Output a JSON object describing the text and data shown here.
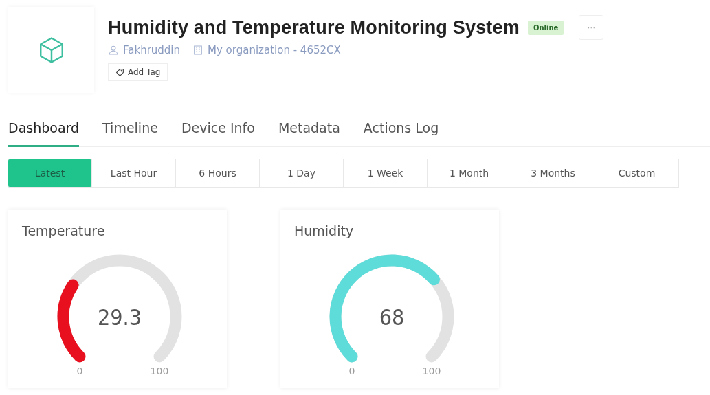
{
  "device": {
    "title": "Humidity and Temperature Monitoring System",
    "status": "Online",
    "owner": "Fakhruddin",
    "organization": "My organization - 4652CX",
    "add_tag": "Add Tag",
    "menu": "···"
  },
  "tabs": [
    {
      "label": "Dashboard",
      "selected": true
    },
    {
      "label": "Timeline",
      "selected": false
    },
    {
      "label": "Device Info",
      "selected": false
    },
    {
      "label": "Metadata",
      "selected": false
    },
    {
      "label": "Actions Log",
      "selected": false
    }
  ],
  "time_ranges": [
    {
      "label": "Latest",
      "selected": true
    },
    {
      "label": "Last Hour",
      "selected": false
    },
    {
      "label": "6 Hours",
      "selected": false
    },
    {
      "label": "1 Day",
      "selected": false
    },
    {
      "label": "1 Week",
      "selected": false
    },
    {
      "label": "1 Month",
      "selected": false
    },
    {
      "label": "3 Months",
      "selected": false
    },
    {
      "label": "Custom",
      "selected": false
    }
  ],
  "widgets": [
    {
      "title": "Temperature",
      "value": "29.3",
      "min": "0",
      "max": "100",
      "color": "#e8101f"
    },
    {
      "title": "Humidity",
      "value": "68",
      "min": "0",
      "max": "100",
      "color": "#5edcd9"
    }
  ]
}
